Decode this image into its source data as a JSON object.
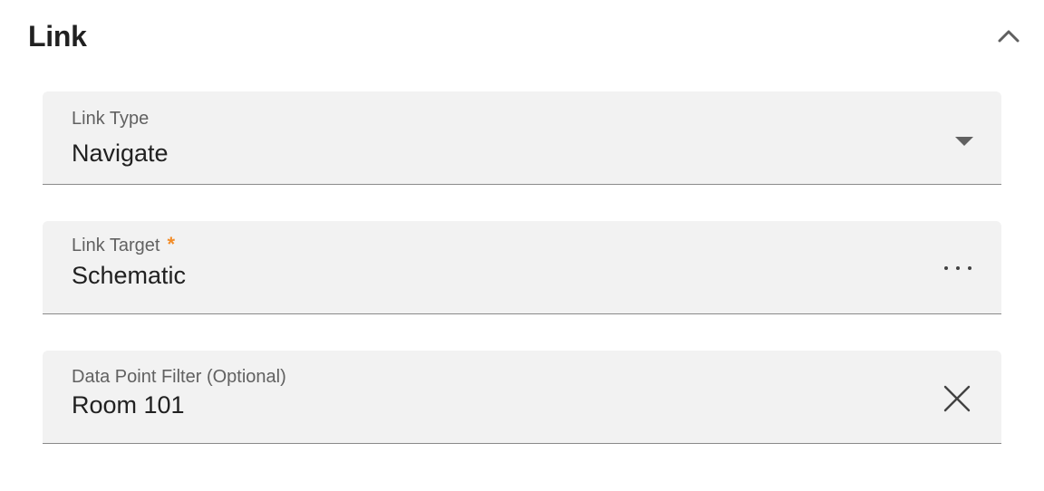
{
  "section": {
    "title": "Link",
    "collapse_icon": "chevron-up-icon"
  },
  "fields": {
    "link_type": {
      "label": "Link Type",
      "value": "Navigate",
      "icon": "dropdown-arrow-icon"
    },
    "link_target": {
      "label": "Link Target",
      "required_mark": "*",
      "value": "Schematic",
      "icon": "more-horizontal-icon"
    },
    "data_point_filter": {
      "label": "Data Point Filter (Optional)",
      "value": "Room 101",
      "icon": "clear-icon"
    }
  },
  "colors": {
    "field_background": "#f2f2f2",
    "required_accent": "#f28c28",
    "label_text": "#616161",
    "value_text": "#212121"
  }
}
